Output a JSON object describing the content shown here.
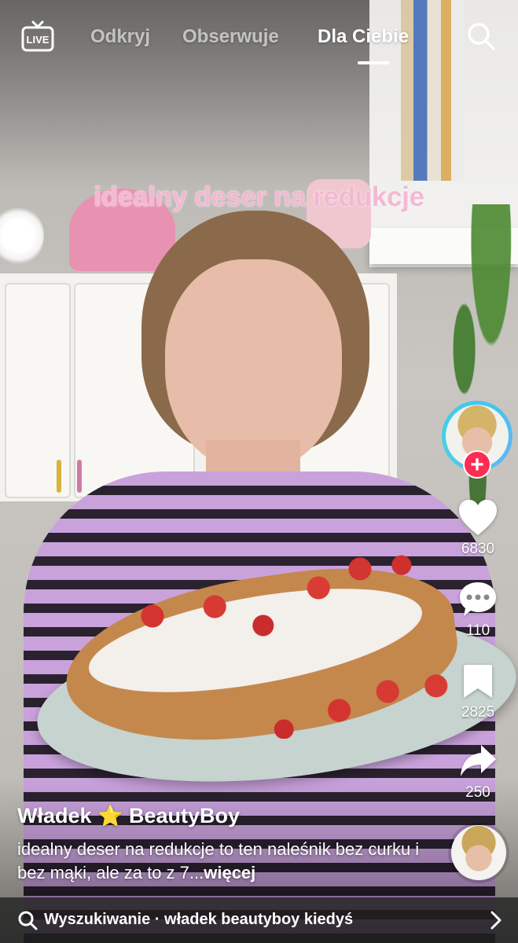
{
  "topbar": {
    "live_icon": "live-tv-icon",
    "live_label": "LIVE",
    "tabs": [
      {
        "label": "Odkryj",
        "active": false
      },
      {
        "label": "Obserwuje",
        "active": false
      },
      {
        "label": "Dla Ciebie",
        "active": true
      }
    ],
    "search_icon": "search-icon"
  },
  "video": {
    "overlay_caption": "idealny deser na redukcje"
  },
  "actions": {
    "follow_icon": "plus-icon",
    "likes": "6830",
    "comments": "110",
    "saves": "2825",
    "shares": "250"
  },
  "info": {
    "author_first": "Władek",
    "author_star": "⭐",
    "author_last": "BeautyBoy",
    "description": "idealny deser na redukcje to ten naleśnik bez curku i bez mąki, ale za to z 7...",
    "more_label": "więcej"
  },
  "searchbar": {
    "text": "Wyszukiwanie · władek beautyboy kiedyś",
    "chevron_icon": "chevron-right-icon"
  },
  "colors": {
    "accent_red": "#fe2c55",
    "caption_pink": "#f3b8d2",
    "avatar_ring": "#41c6ef"
  }
}
